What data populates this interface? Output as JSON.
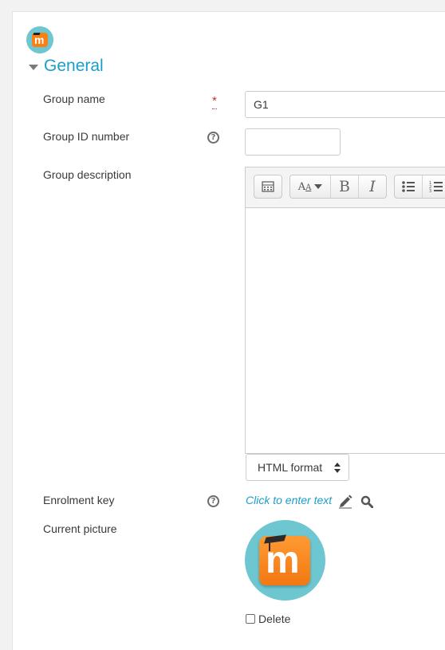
{
  "form": {
    "section_title": "General",
    "group_name": {
      "label": "Group name",
      "value": "G1",
      "required_marker": "*"
    },
    "group_id_number": {
      "label": "Group ID number",
      "value": ""
    },
    "group_description": {
      "label": "Group description"
    },
    "description_format": {
      "selected": "HTML format"
    },
    "enrolment_key": {
      "label": "Enrolment key",
      "link_text": "Click to enter text"
    },
    "current_picture": {
      "label": "Current picture",
      "delete_label": "Delete",
      "logo_letter": "m"
    }
  },
  "editor_toolbar": {
    "bold_glyph": "B",
    "italic_glyph": "I",
    "font_glyph": "A"
  },
  "icons": {
    "help": "?",
    "section_caret": "caret-down-icon"
  },
  "colors": {
    "accent": "#1a9ec9",
    "required": "#c9302c",
    "logo_circle": "#6ec6d0",
    "logo_tile": "#f98012"
  }
}
